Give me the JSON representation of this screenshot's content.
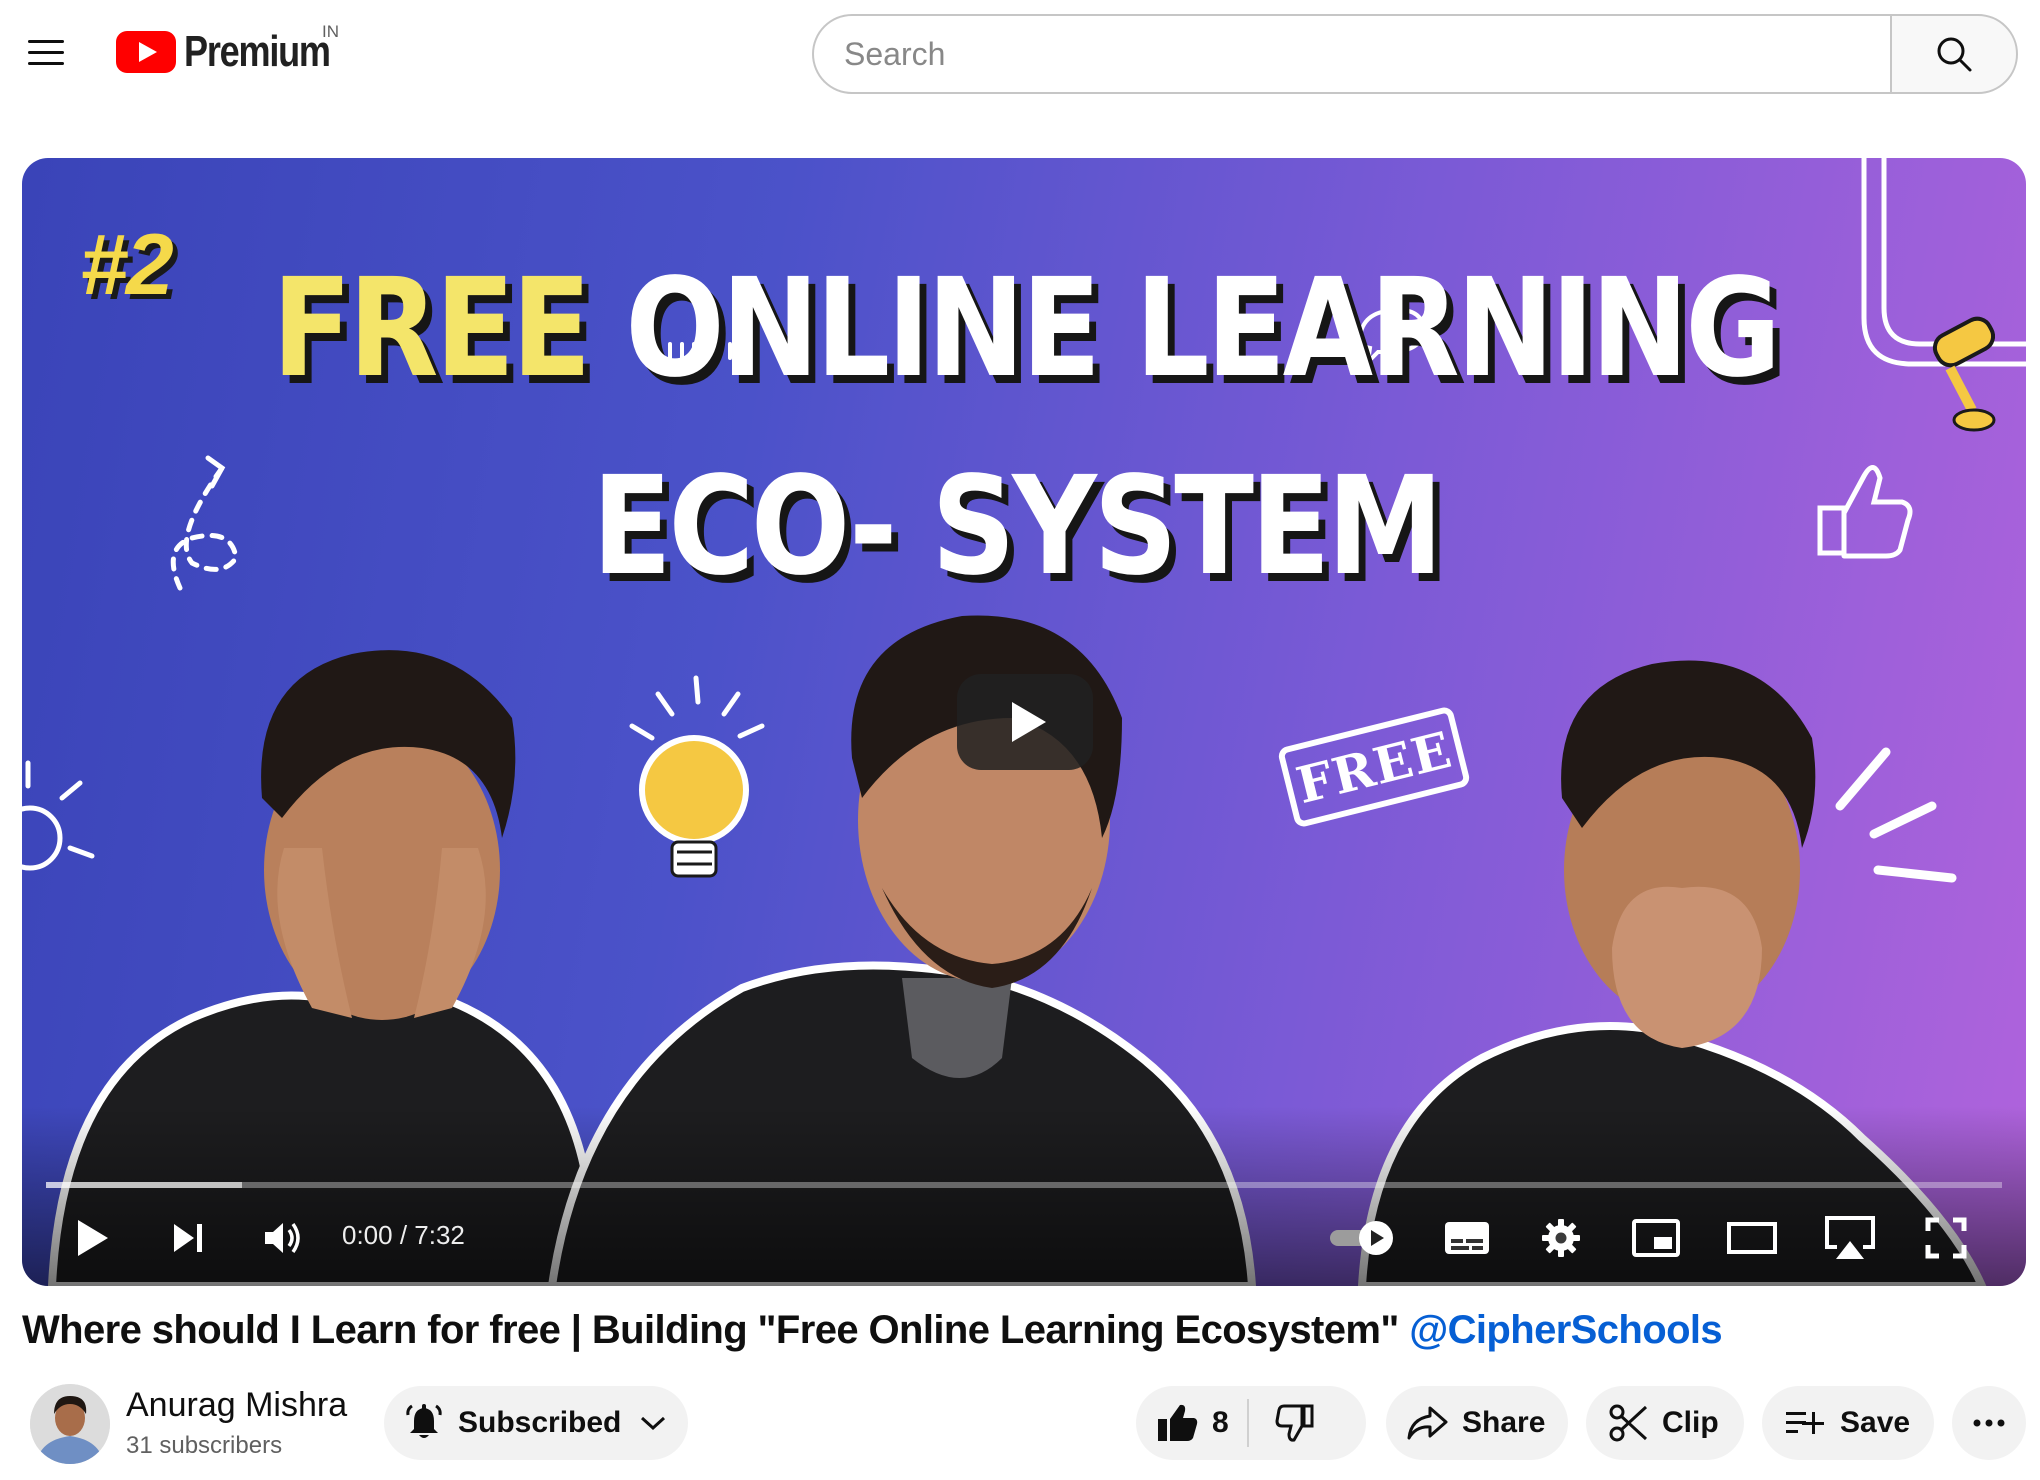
{
  "header": {
    "logo_text": "Premium",
    "region": "IN",
    "search_placeholder": "Search"
  },
  "player": {
    "thumbnail": {
      "badge": "#2",
      "line1_highlight": "FREE",
      "line1_rest": "ONLINE LEARNING",
      "line2": "ECO- SYSTEM",
      "stamp": "FREE"
    },
    "time_display": "0:00 / 7:32",
    "buffered_fraction": 0.1
  },
  "video": {
    "title": "Where should I Learn for free | Building \"Free Online Learning Ecosystem\" ",
    "mention": "@CipherSchools"
  },
  "owner": {
    "channel_name": "Anurag Mishra",
    "subscribers": "31 subscribers",
    "subscribe_label": "Subscribed"
  },
  "actions": {
    "like_count": "8",
    "share_label": "Share",
    "clip_label": "Clip",
    "save_label": "Save"
  },
  "colors": {
    "brand_red": "#ff0000",
    "link_blue": "#065fd4",
    "thumb_yellow": "#f4e56a"
  }
}
